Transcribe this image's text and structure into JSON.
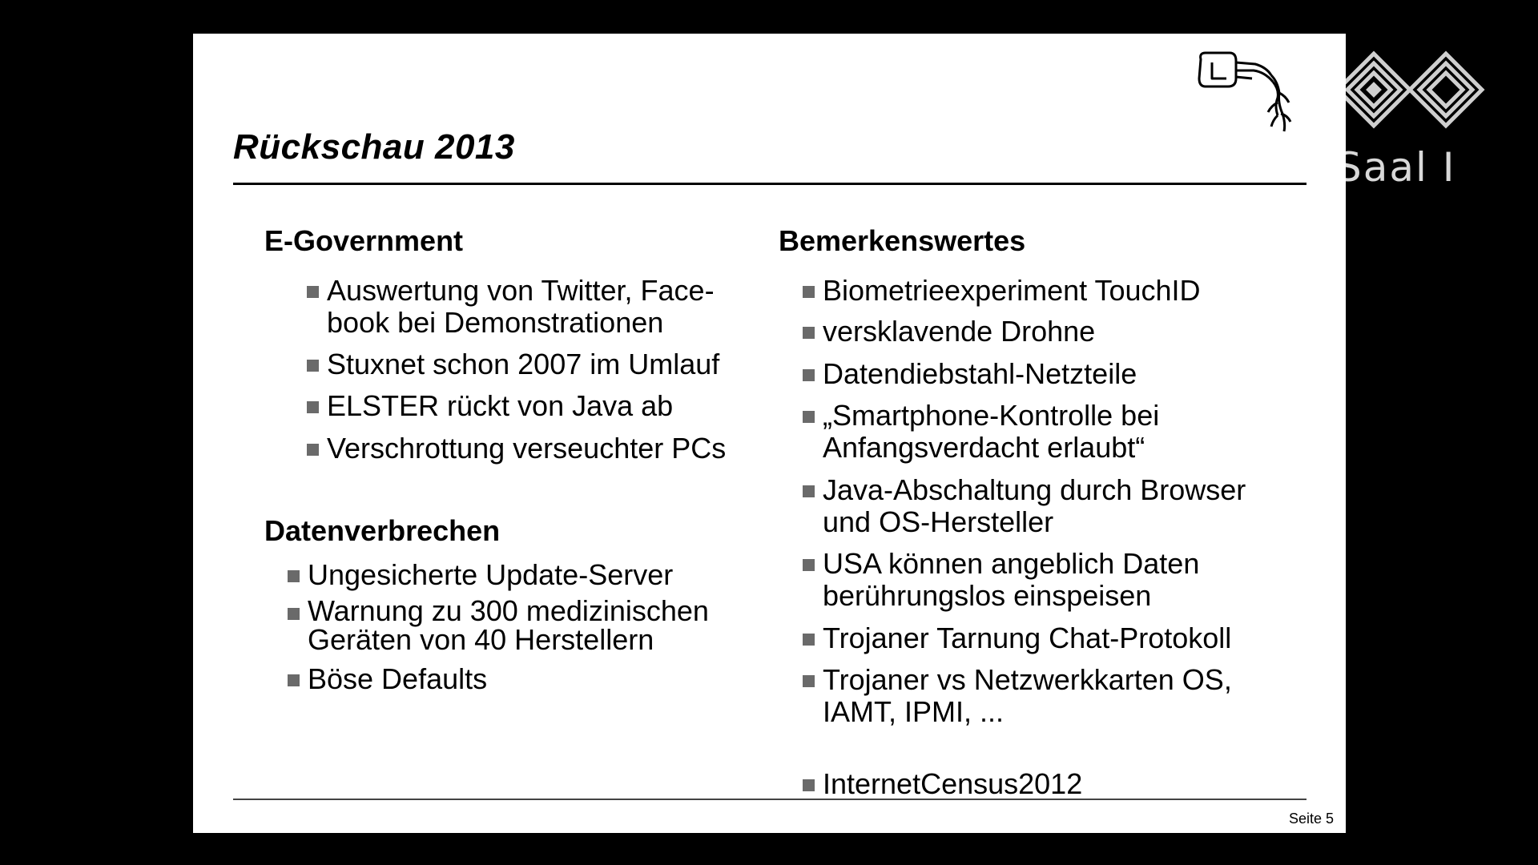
{
  "slide": {
    "title": "Rückschau 2013",
    "page_number": "Seite 5"
  },
  "left_column": {
    "sections": [
      {
        "heading": "E-Government",
        "items": [
          "Auswertung von Twitter, Face-\nbook bei Demonstrationen",
          "Stuxnet schon 2007 im Umlauf",
          "ELSTER rückt von Java ab",
          "Verschrottung verseuchter PCs"
        ]
      },
      {
        "heading": "Datenverbrechen",
        "items": [
          "Ungesicherte Update-Server",
          "Warnung zu 300 medizinischen\nGeräten von 40 Herstellern",
          "Böse Defaults"
        ]
      }
    ]
  },
  "right_column": {
    "heading": "Bemerkenswertes",
    "items": [
      "Biometrieexperiment TouchID",
      "versklavende Drohne",
      "Datendiebstahl-Netzteile",
      "„Smartphone-Kontrolle bei\nAnfangsverdacht erlaubt“",
      "Java-Abschaltung durch Browser\nund OS-Hersteller",
      "USA können angeblich Daten\nberührungslos einspeisen",
      "Trojaner Tarnung Chat-Protokoll",
      "Trojaner vs Netzwerkkarten OS,\nIAMT, IPMI, ...",
      "InternetCensus2012"
    ]
  },
  "overlay": {
    "label": "Saal I",
    "logo_icon": "ccc-congress-logo-icon"
  },
  "slide_logo_icon": "plug-cable-logo-icon",
  "colors": {
    "background": "#000000",
    "slide": "#ffffff",
    "bullet": "#6a6a6a",
    "overlay_text": "#d8d8d8"
  }
}
